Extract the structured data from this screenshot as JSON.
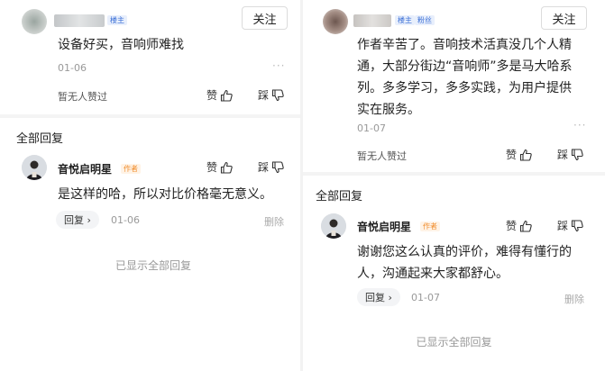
{
  "colors": {
    "accent_blue": "#3b6fd6",
    "author_orange": "#f08c2b",
    "muted": "#999999"
  },
  "left": {
    "header": {
      "floor_tag": "楼主",
      "follow_label": "关注"
    },
    "comment": {
      "text": "设备好买，音响师难找",
      "date": "01-06",
      "more": "···",
      "no_likes": "暂无人赞过",
      "like_label": "赞",
      "dislike_label": "踩"
    },
    "section_title": "全部回复",
    "reply": {
      "author": "音悦启明星",
      "author_tag": "作者",
      "like_label": "赞",
      "dislike_label": "踩",
      "text": "是这样的哈，所以对比价格毫无意义。",
      "reply_label": "回复 ›",
      "date": "01-06",
      "delete_label": "删除"
    },
    "all_shown": "已显示全部回复"
  },
  "right": {
    "header": {
      "floor_tag": "楼主",
      "fan_tag": "粉丝",
      "follow_label": "关注"
    },
    "comment": {
      "lines": [
        "作者辛苦了。音响技术活真没几个人精",
        "通，大部分街边“音响师”多是马大哈系",
        "列。多多学习，多多实践，为用户提供",
        "实在服务。"
      ],
      "date": "01-07",
      "more": "···",
      "no_likes": "暂无人赞过",
      "like_label": "赞",
      "dislike_label": "踩"
    },
    "section_title": "全部回复",
    "reply": {
      "author": "音悦启明星",
      "author_tag": "作者",
      "like_label": "赞",
      "dislike_label": "踩",
      "lines": [
        "谢谢您这么认真的评价，难得有懂行的",
        "人，沟通起来大家都舒心。"
      ],
      "reply_label": "回复 ›",
      "date": "01-07",
      "delete_label": "删除"
    },
    "all_shown": "已显示全部回复"
  }
}
